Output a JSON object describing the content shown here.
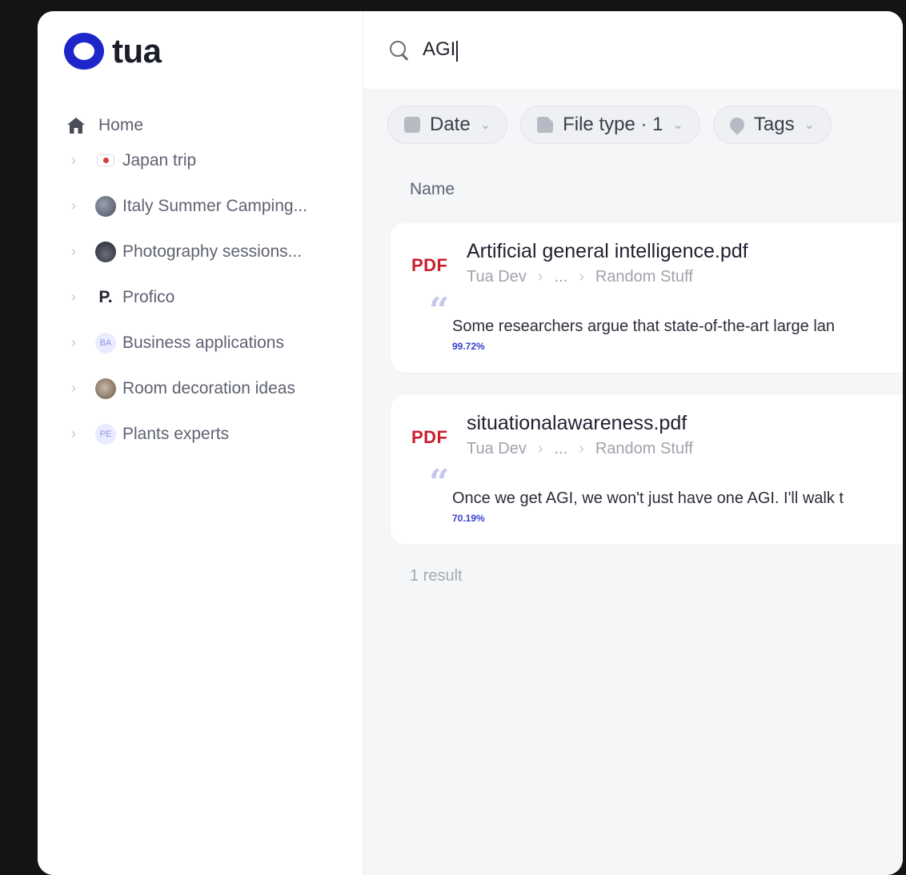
{
  "app": {
    "logo_text": "tua",
    "brand_color": "#1d26c9"
  },
  "sidebar": {
    "home_label": "Home",
    "items": [
      {
        "label": "Japan trip",
        "icon": "japan-flag-icon"
      },
      {
        "label": "Italy Summer Camping...",
        "icon": "photo-avatar-icon"
      },
      {
        "label": "Photography sessions...",
        "icon": "photo-avatar-icon"
      },
      {
        "label": "Profico",
        "icon": "p-letter-icon",
        "icon_text": "P."
      },
      {
        "label": "Business applications",
        "icon": "initials-avatar-icon",
        "icon_text": "BA"
      },
      {
        "label": "Room decoration ideas",
        "icon": "photo-avatar-icon"
      },
      {
        "label": "Plants experts",
        "icon": "initials-avatar-icon",
        "icon_text": "PE"
      }
    ]
  },
  "search": {
    "value": "AGI"
  },
  "filters": {
    "date_label": "Date",
    "filetype_label": "File type · 1",
    "tags_label": "Tags"
  },
  "table": {
    "name_header": "Name"
  },
  "results": [
    {
      "type_badge": "PDF",
      "file_name": "Artificial general intelligence.pdf",
      "breadcrumb": {
        "root": "Tua Dev",
        "middle": "...",
        "leaf": "Random Stuff"
      },
      "snippet": "Some researchers argue that state-of-the-art large lan",
      "score": "99.72%"
    },
    {
      "type_badge": "PDF",
      "file_name": "situationalawareness.pdf",
      "breadcrumb": {
        "root": "Tua Dev",
        "middle": "...",
        "leaf": "Random Stuff"
      },
      "snippet": "Once we get AGI, we won't just have one AGI. I'll walk t",
      "score": "70.19%"
    }
  ],
  "footer": {
    "result_count": "1 result"
  },
  "colors": {
    "pdf_red": "#c8202d",
    "accent_blue": "#3a3fcf"
  }
}
